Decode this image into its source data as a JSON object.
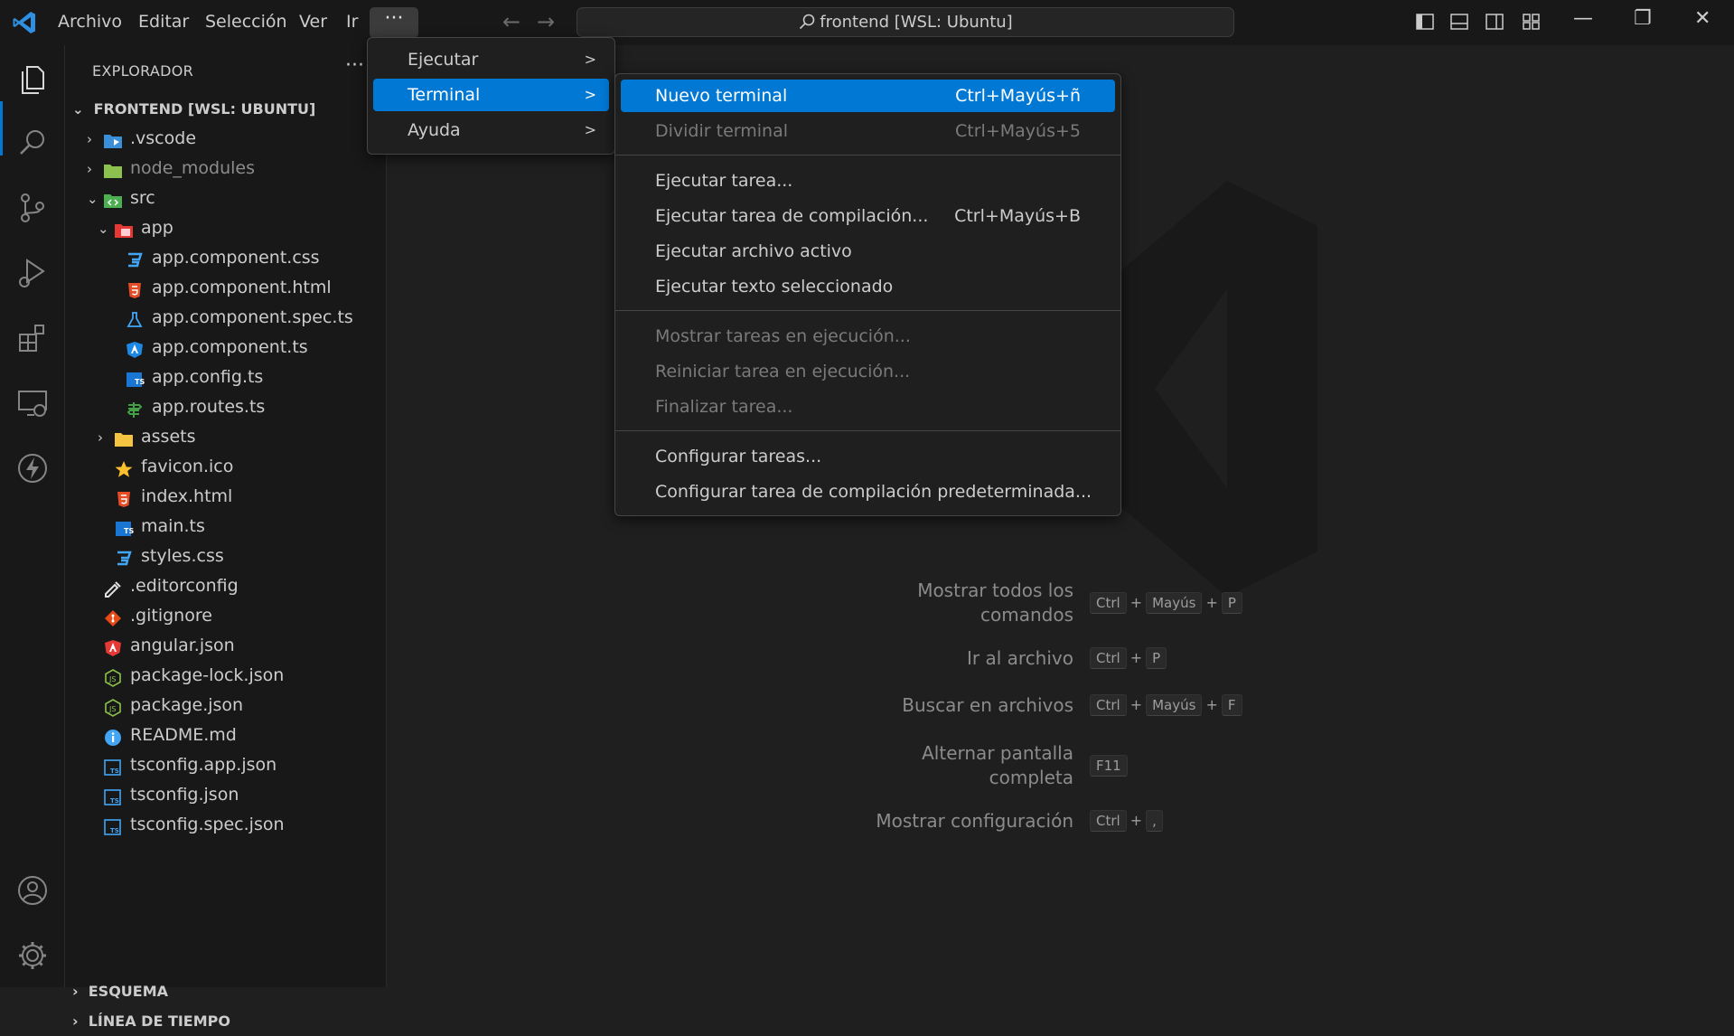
{
  "titlebar": {
    "menus": [
      "Archivo",
      "Editar",
      "Selección",
      "Ver",
      "Ir"
    ],
    "more_label": "···",
    "search_text": "frontend [WSL: Ubuntu]"
  },
  "sidebar": {
    "title": "EXPLORADOR",
    "root": "FRONTEND [WSL: UBUNTU]",
    "tree": [
      {
        "label": ".vscode",
        "level": 1,
        "chevron": "›",
        "icon": "vscode-folder-icon"
      },
      {
        "label": "node_modules",
        "level": 1,
        "chevron": "›",
        "icon": "node-folder-icon",
        "dim": true
      },
      {
        "label": "src",
        "level": 1,
        "chevron": "⌄",
        "icon": "src-folder-icon"
      },
      {
        "label": "app",
        "level": 2,
        "chevron": "⌄",
        "icon": "app-folder-icon"
      },
      {
        "label": "app.component.css",
        "level": 3,
        "icon": "css-icon"
      },
      {
        "label": "app.component.html",
        "level": 3,
        "icon": "html-icon"
      },
      {
        "label": "app.component.spec.ts",
        "level": 3,
        "icon": "test-icon"
      },
      {
        "label": "app.component.ts",
        "level": 3,
        "icon": "angular-component-icon"
      },
      {
        "label": "app.config.ts",
        "level": 3,
        "icon": "ts-icon"
      },
      {
        "label": "app.routes.ts",
        "level": 3,
        "icon": "routes-icon"
      },
      {
        "label": "assets",
        "level": 2,
        "chevron": "›",
        "icon": "assets-folder-icon"
      },
      {
        "label": "favicon.ico",
        "level": 2,
        "icon": "star-icon"
      },
      {
        "label": "index.html",
        "level": 2,
        "icon": "html-icon"
      },
      {
        "label": "main.ts",
        "level": 2,
        "icon": "ts-icon"
      },
      {
        "label": "styles.css",
        "level": 2,
        "icon": "css-icon"
      },
      {
        "label": ".editorconfig",
        "level": 1,
        "icon": "editorconfig-icon"
      },
      {
        "label": ".gitignore",
        "level": 1,
        "icon": "git-icon"
      },
      {
        "label": "angular.json",
        "level": 1,
        "icon": "angular-icon"
      },
      {
        "label": "package-lock.json",
        "level": 1,
        "icon": "node-icon"
      },
      {
        "label": "package.json",
        "level": 1,
        "icon": "node-icon"
      },
      {
        "label": "README.md",
        "level": 1,
        "icon": "info-icon"
      },
      {
        "label": "tsconfig.app.json",
        "level": 1,
        "icon": "tsconfig-icon"
      },
      {
        "label": "tsconfig.json",
        "level": 1,
        "icon": "tsconfig-icon"
      },
      {
        "label": "tsconfig.spec.json",
        "level": 1,
        "icon": "tsconfig-icon"
      }
    ],
    "sections": [
      "ESQUEMA",
      "LÍNEA DE TIEMPO"
    ]
  },
  "main_menu": [
    {
      "label": "Ejecutar",
      "arrow": ">"
    },
    {
      "label": "Terminal",
      "arrow": ">",
      "selected": true
    },
    {
      "label": "Ayuda",
      "arrow": ">"
    }
  ],
  "terminal_menu": {
    "groups": [
      [
        {
          "label": "Nuevo terminal",
          "key": "Ctrl+Mayús+ñ",
          "selected": true
        },
        {
          "label": "Dividir terminal",
          "key": "Ctrl+Mayús+5",
          "disabled": true
        }
      ],
      [
        {
          "label": "Ejecutar tarea...",
          "key": ""
        },
        {
          "label": "Ejecutar tarea de compilación...",
          "key": "Ctrl+Mayús+B"
        },
        {
          "label": "Ejecutar archivo activo",
          "key": ""
        },
        {
          "label": "Ejecutar texto seleccionado",
          "key": ""
        }
      ],
      [
        {
          "label": "Mostrar tareas en ejecución...",
          "key": "",
          "disabled": true
        },
        {
          "label": "Reiniciar tarea en ejecución...",
          "key": "",
          "disabled": true
        },
        {
          "label": "Finalizar tarea...",
          "key": "",
          "disabled": true
        }
      ],
      [
        {
          "label": "Configurar tareas...",
          "key": ""
        },
        {
          "label": "Configurar tarea de compilación predeterminada...",
          "key": ""
        }
      ]
    ]
  },
  "shortcuts": [
    {
      "label": [
        "Mostrar todos los",
        "comandos"
      ],
      "keys": [
        "Ctrl",
        "Mayús",
        "P"
      ]
    },
    {
      "label": [
        "Ir al archivo"
      ],
      "keys": [
        "Ctrl",
        "P"
      ]
    },
    {
      "label": [
        "Buscar en archivos"
      ],
      "keys": [
        "Ctrl",
        "Mayús",
        "F"
      ]
    },
    {
      "label": [
        "Alternar pantalla",
        "completa"
      ],
      "keys": [
        "F11"
      ]
    },
    {
      "label": [
        "Mostrar configuración"
      ],
      "keys": [
        "Ctrl",
        ","
      ]
    }
  ],
  "colors": {
    "accent": "#0078d4",
    "background": "#1f1f1f",
    "bar": "#181818"
  }
}
